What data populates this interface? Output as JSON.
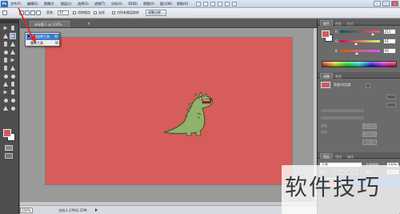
{
  "menubar": {
    "logo": "Ps",
    "items": [
      "文件(F)",
      "编辑(E)",
      "图像(I)",
      "图层(L)",
      "选择(S)",
      "滤镜(T)",
      "分析(A)",
      "3D(D)",
      "视图(V)",
      "窗口(W)",
      "帮助(H)"
    ],
    "window_buttons": [
      "—",
      "□",
      "×"
    ]
  },
  "options": {
    "tolerance_label": "容差:",
    "tolerance_value": "32",
    "antialias_label": "消除锯齿",
    "contiguous_label": "连续",
    "all_layers_label": "对所有图层取样",
    "refine_edge_label": "调整边缘..."
  },
  "document": {
    "tab_label": "未标题-1 @ 100%...",
    "close": "×"
  },
  "statusbar": {
    "zoom": "100%",
    "doc_info": "文档:1.37M/1.37M"
  },
  "flyout": {
    "items": [
      {
        "label": "快速选择工具",
        "key": "W"
      },
      {
        "label": "魔棒工具",
        "key": "W"
      }
    ]
  },
  "panels": {
    "color_tabs": [
      "颜色",
      "色板",
      "样式"
    ],
    "sliders": [
      {
        "letter": "R",
        "value": "211"
      },
      {
        "letter": "G",
        "value": "91"
      },
      {
        "letter": "B",
        "value": "95"
      }
    ],
    "adjust_tabs": [
      "调整",
      "蒙版"
    ],
    "adjust_title": "亮度/对比度",
    "ghost_buttons": [
      "添加调整",
      "添加蒙版",
      "浓度",
      "羽化",
      "蒙版边缘",
      "颜色范围",
      "反相"
    ],
    "layers_tabs": [
      "图层",
      "通道",
      "路径"
    ],
    "blend_mode": "正常",
    "opacity_label": "不透明度:",
    "opacity_value": "100%",
    "lock_label": "锁定:",
    "fill_label": "填充:",
    "fill_value": "100%",
    "layer_name": "背景"
  },
  "watermark": {
    "text": "软件技巧"
  },
  "colors": {
    "canvas": "#d65d59",
    "foreground": "#d35b5f",
    "dino_body": "#8fb36a",
    "annotation": "#e0251c"
  }
}
